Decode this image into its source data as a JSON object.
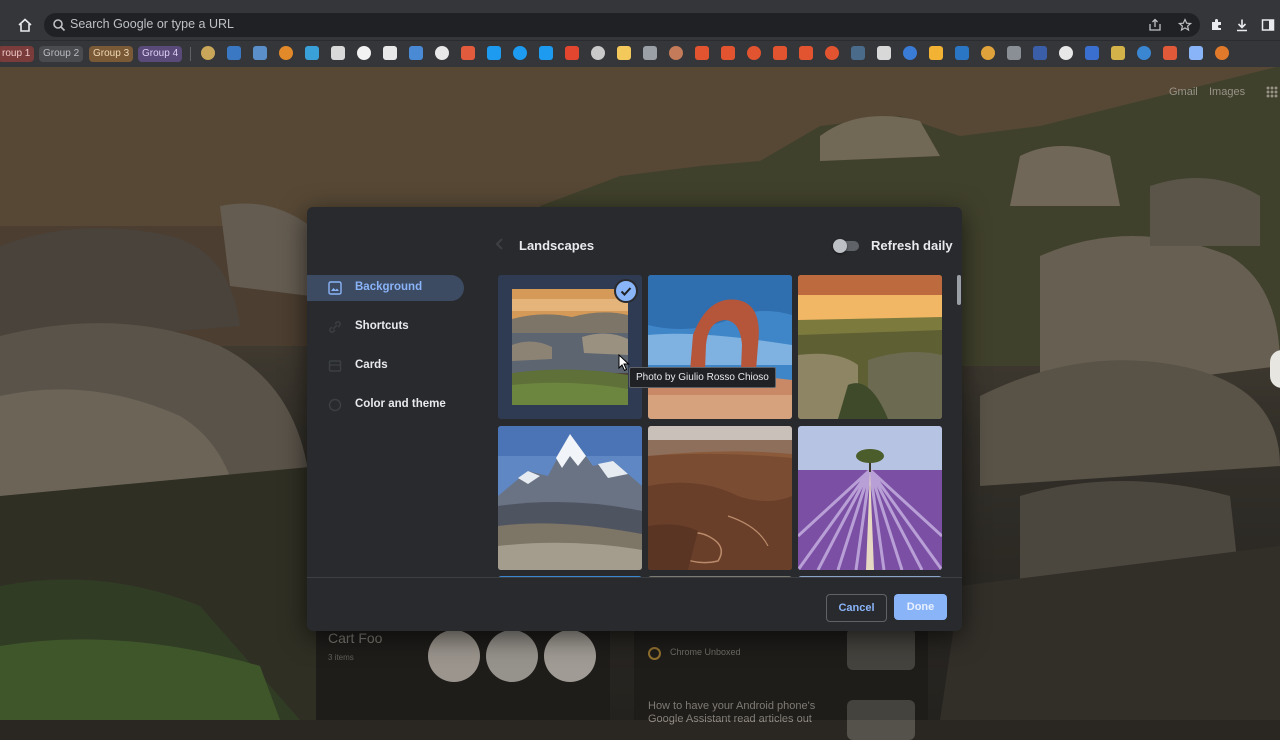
{
  "browser": {
    "omnibox": {
      "placeholder": "Search Google or type a URL"
    },
    "tab_groups": [
      {
        "label": "roup 1",
        "color": "#7a3b3b"
      },
      {
        "label": "Group 2",
        "color": "#4a4b4f"
      },
      {
        "label": "Group 3",
        "color": "#7a5a36"
      },
      {
        "label": "Group 4",
        "color": "#5a4a7a"
      }
    ],
    "toolbar_icons": [
      "home-icon",
      "share-icon",
      "star-icon",
      "extensions-icon",
      "download-icon",
      "side-panel-icon"
    ]
  },
  "ntp": {
    "links": {
      "gmail": "Gmail",
      "images": "Images"
    },
    "cart_card": {
      "title": "Cart Foo",
      "subtitle": "3 items"
    },
    "news_card": {
      "source": "Chrome Unboxed",
      "headline_1": "How to have your Android phone's",
      "headline_2": "Google Assistant read articles out"
    }
  },
  "dialog": {
    "title": "Landscapes",
    "refresh_daily": {
      "label": "Refresh daily",
      "enabled": false
    },
    "sidebar": [
      {
        "label": "Background",
        "icon": "image-icon",
        "active": true
      },
      {
        "label": "Shortcuts",
        "icon": "link-icon",
        "active": false
      },
      {
        "label": "Cards",
        "icon": "cards-icon",
        "active": false
      },
      {
        "label": "Color and theme",
        "icon": "palette-icon",
        "active": false
      }
    ],
    "tiles": [
      {
        "name": "coastal-rocks",
        "selected": true
      },
      {
        "name": "red-arch",
        "selected": false
      },
      {
        "name": "canyon-sunset",
        "selected": false
      },
      {
        "name": "snowy-mountain",
        "selected": false
      },
      {
        "name": "desert-valley",
        "selected": false
      },
      {
        "name": "lavender-field",
        "selected": false
      }
    ],
    "tooltip": "Photo by Giulio Rosso Chioso",
    "buttons": {
      "cancel": "Cancel",
      "done": "Done"
    },
    "accent": "#8ab4f8"
  }
}
